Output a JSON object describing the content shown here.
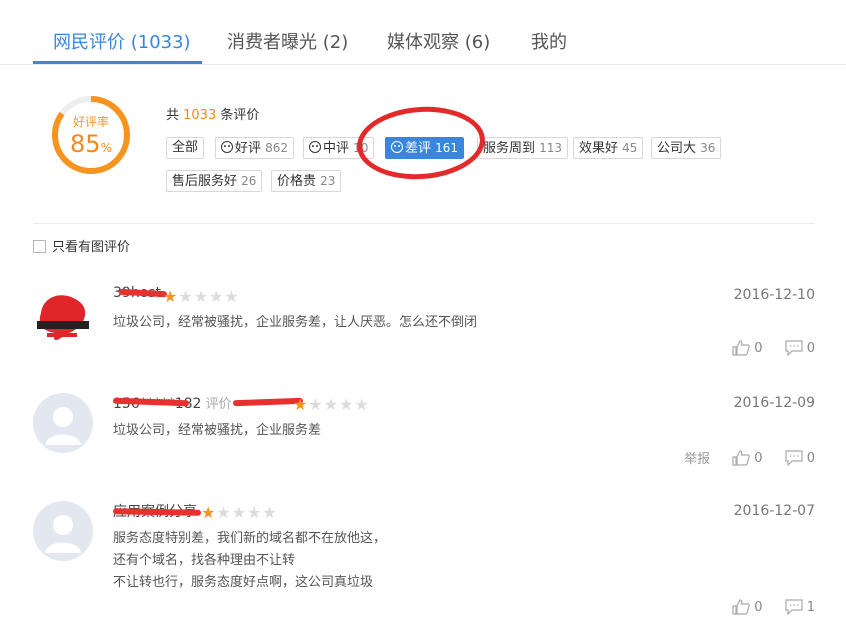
{
  "tabs": [
    {
      "label": "网民评价 (1033)",
      "active": true
    },
    {
      "label": "消费者曝光 (2)",
      "active": false
    },
    {
      "label": "媒体观察 (6)",
      "active": false
    },
    {
      "label": "我的",
      "active": false
    }
  ],
  "rating": {
    "label": "好评率",
    "value": "85",
    "unit": "%",
    "fraction": 0.85
  },
  "total": {
    "prefix": "共 ",
    "count": "1033",
    "suffix": " 条评价"
  },
  "tags": [
    {
      "label": "全部",
      "count": ""
    },
    {
      "label": "好评",
      "count": "862",
      "icon": "smile-icon"
    },
    {
      "label": "中评",
      "count": "10",
      "icon": "neutral-face-icon"
    },
    {
      "label": "差评",
      "count": "161",
      "icon": "sad-face-icon",
      "selected": true
    },
    {
      "label": "服务周到",
      "count": "113"
    },
    {
      "label": "效果好",
      "count": "45"
    },
    {
      "label": "公司大",
      "count": "36"
    },
    {
      "label": "售后服务好",
      "count": "26"
    },
    {
      "label": "价格贵",
      "count": "23"
    }
  ],
  "filter": {
    "label": "只看有图评价"
  },
  "reviews": [
    {
      "name": "39host",
      "eval_label": "",
      "stars": 1,
      "date": "2016-12-10",
      "lines": [
        "垃圾公司，经常被骚扰，企业服务差，让人厌恶。怎么还不倒闭"
      ],
      "report": "",
      "likes": "0",
      "comments": "0"
    },
    {
      "name": "156*****182",
      "eval_label": "评价",
      "stars": 1,
      "date": "2016-12-09",
      "lines": [
        "垃圾公司，经常被骚扰，企业服务差"
      ],
      "report": "举报",
      "likes": "0",
      "comments": "0"
    },
    {
      "name": "应用案例分享",
      "eval_label": "",
      "stars": 1,
      "date": "2016-12-07",
      "lines": [
        "服务态度特别差，我们新的域名都不在放他这，",
        "还有个域名，找各种理由不让转",
        "不让转也行，服务态度好点啊，这公司真垃圾"
      ],
      "report": "",
      "likes": "0",
      "comments": "1"
    }
  ]
}
